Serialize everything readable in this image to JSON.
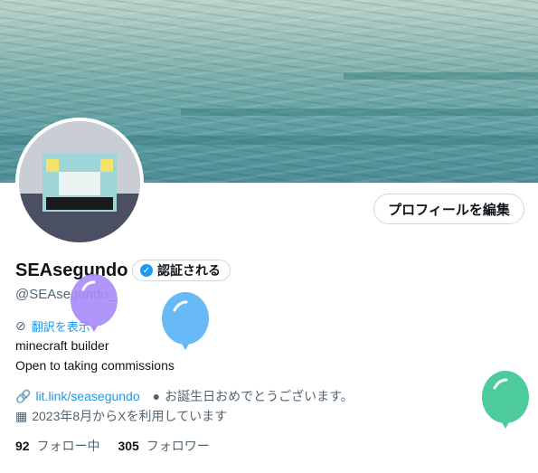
{
  "profile": {
    "display_name": "SEAsegundo",
    "verified_label": "認証される",
    "handle": "@SEAsegundo_",
    "edit_button": "プロフィールを編集",
    "translate_label": "翻訳を表示",
    "bio_line1": "minecraft builder",
    "bio_line2": "Open to taking commissions",
    "link_text": "lit.link/seasegundo",
    "birthday_text": "お誕生日おめでとうございます。",
    "joined_text": "2023年8月からXを利用しています",
    "following_count": "92",
    "following_label": "フォロー中",
    "followers_count": "305",
    "followers_label": "フォロワー"
  },
  "icons": {
    "verified": "verified-badge-icon",
    "translate": "translate-icon",
    "link": "link-icon",
    "birthday": "balloon-icon",
    "calendar": "calendar-icon"
  },
  "colors": {
    "accent": "#1d9bf0",
    "balloon_purple": "#a78bfa",
    "balloon_blue": "#5fb6f5",
    "balloon_green": "#4ecb9b"
  }
}
